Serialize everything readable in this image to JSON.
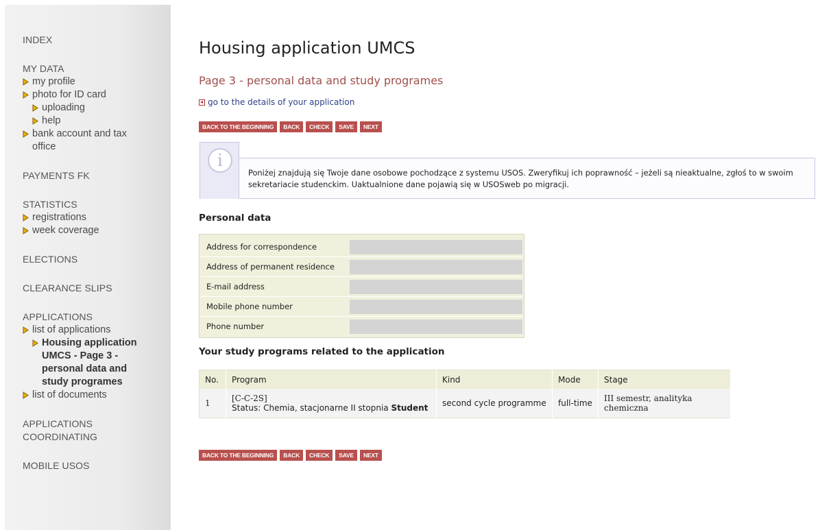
{
  "sidebar": {
    "sections": [
      {
        "title": "INDEX",
        "items": []
      },
      {
        "title": "MY DATA",
        "items": [
          {
            "label": "my profile",
            "level": 1
          },
          {
            "label": "photo for ID card",
            "level": 1
          },
          {
            "label": "uploading",
            "level": 2
          },
          {
            "label": "help",
            "level": 2
          },
          {
            "label": "bank account and tax office",
            "level": 1
          }
        ]
      },
      {
        "title": "PAYMENTS FK",
        "items": []
      },
      {
        "title": "STATISTICS",
        "items": [
          {
            "label": "registrations",
            "level": 1
          },
          {
            "label": "week coverage",
            "level": 1
          }
        ]
      },
      {
        "title": "ELECTIONS",
        "items": []
      },
      {
        "title": "CLEARANCE SLIPS",
        "items": []
      },
      {
        "title": "APPLICATIONS",
        "items": [
          {
            "label": "list of applications",
            "level": 1
          },
          {
            "label": "Housing application UMCS - Page 3 - personal data and study programes",
            "level": 2,
            "active": true
          },
          {
            "label": "list of documents",
            "level": 1
          }
        ]
      },
      {
        "title": "APPLICATIONS COORDINATING",
        "items": []
      },
      {
        "title": "MOBILE USOS",
        "items": []
      }
    ]
  },
  "main": {
    "title": "Housing application UMCS",
    "subtitle": "Page 3 - personal data and study programes",
    "details_link": "go to the details of your application",
    "buttons": [
      "BACK TO THE BEGINNING",
      "BACK",
      "CHECK",
      "SAVE",
      "NEXT"
    ],
    "info_text": "Poniżej znajdują się Twoje dane osobowe pochodzące z systemu USOS. Zweryfikuj ich poprawność – jeżeli są nieaktualne, zgłoś to w swoim sekretariacie studenckim. Uaktualnione dane pojawią się w USOSweb po migracji.",
    "personal_heading": "Personal data",
    "personal_fields": [
      "Address for correspondence",
      "Address of permanent residence",
      "E-mail address",
      "Mobile phone number",
      "Phone number"
    ],
    "programs_heading": "Your study programs related to the application",
    "programs_table": {
      "headers": [
        "No.",
        "Program",
        "Kind",
        "Mode",
        "Stage"
      ],
      "rows": [
        {
          "no": "1",
          "code": "[C-C-2S]",
          "status_prefix": "Status: Chemia, stacjonarne II stopnia",
          "status_bold": "Student",
          "kind": "second cycle programme",
          "mode": "full-time",
          "stage": "III semestr, analityka chemiczna"
        }
      ]
    }
  },
  "colors": {
    "button_bg": "#b8504e",
    "subtitle": "#a0504a",
    "link": "#2c3f8a",
    "bullet": "#e8b400"
  }
}
